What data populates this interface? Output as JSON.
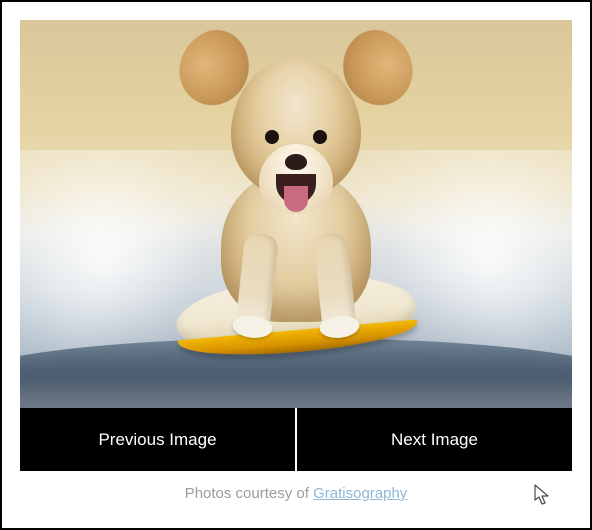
{
  "image": {
    "alt": "A happy golden-furred dog surfing on a yellow surfboard through a breaking ocean wave"
  },
  "nav": {
    "prev_label": "Previous Image",
    "next_label": "Next Image"
  },
  "credit": {
    "prefix": "Photos courtesy of ",
    "link_text": "Gratisography"
  }
}
